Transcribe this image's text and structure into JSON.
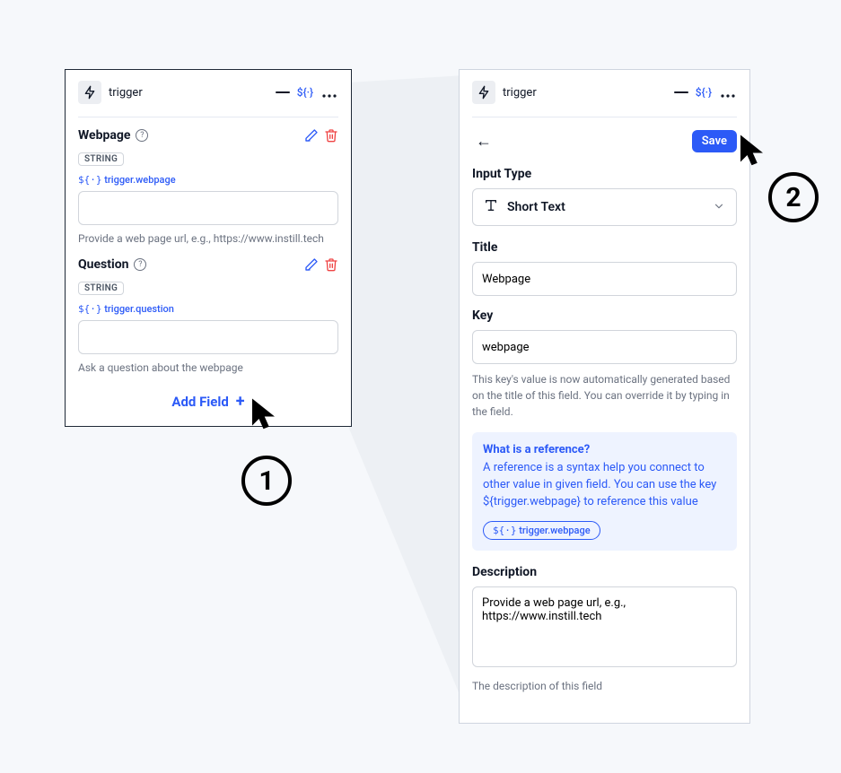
{
  "panels": {
    "left": {
      "header": {
        "name": "trigger",
        "dollar_curly": "${·}"
      },
      "fields": [
        {
          "title": "Webpage",
          "type_badge": "STRING",
          "ref_prefix": "${·}",
          "ref_key": "trigger.webpage",
          "value": "",
          "hint": "Provide a web page url, e.g., https://www.instill.tech"
        },
        {
          "title": "Question",
          "type_badge": "STRING",
          "ref_prefix": "${·}",
          "ref_key": "trigger.question",
          "value": "",
          "hint": "Ask a question about the webpage"
        }
      ],
      "add_field_label": "Add Field"
    },
    "right": {
      "header": {
        "name": "trigger",
        "dollar_curly": "${·}"
      },
      "save_label": "Save",
      "input_type": {
        "label": "Input Type",
        "value": "Short Text"
      },
      "title": {
        "label": "Title",
        "value": "Webpage"
      },
      "key": {
        "label": "Key",
        "value": "webpage",
        "hint": "This key's value is now automatically generated based on the title of this field. You can override it by typing in the field."
      },
      "reference": {
        "title": "What is a reference?",
        "body": "A reference is a syntax help you connect to other value in given field. You can use the key ${trigger.webpage} to reference this value",
        "chip_prefix": "${·}",
        "chip_key": "trigger.webpage"
      },
      "description": {
        "label": "Description",
        "value": "Provide a web page url, e.g., https://www.instill.tech",
        "hint": "The description of this field"
      }
    }
  },
  "callouts": {
    "one": "1",
    "two": "2"
  }
}
